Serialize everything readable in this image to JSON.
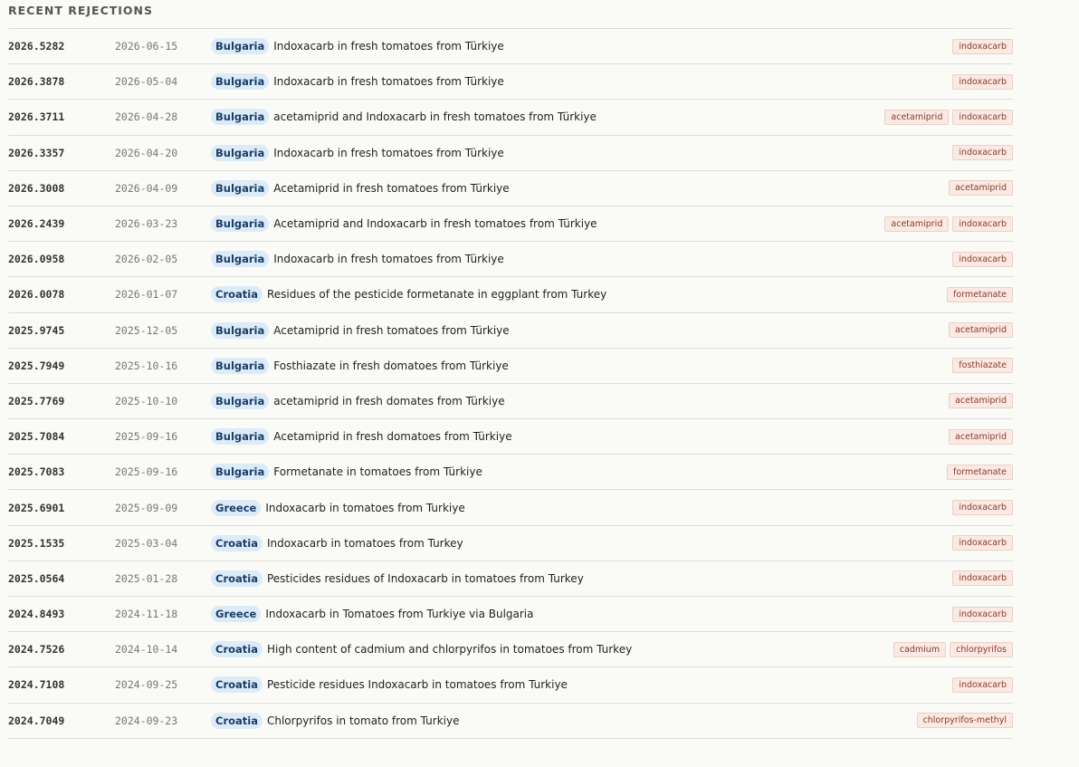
{
  "section_title": "RECENT REJECTIONS",
  "rows": [
    {
      "ref": "2026.5282",
      "date": "2026-06-15",
      "country": "Bulgaria",
      "subject": "Indoxacarb in fresh tomatoes from Türkiye",
      "tags": [
        "indoxacarb"
      ]
    },
    {
      "ref": "2026.3878",
      "date": "2026-05-04",
      "country": "Bulgaria",
      "subject": "Indoxacarb in fresh tomatoes from Türkiye",
      "tags": [
        "indoxacarb"
      ]
    },
    {
      "ref": "2026.3711",
      "date": "2026-04-28",
      "country": "Bulgaria",
      "subject": "acetamiprid and Indoxacarb in fresh tomatoes from Türkiye",
      "tags": [
        "acetamiprid",
        "indoxacarb"
      ]
    },
    {
      "ref": "2026.3357",
      "date": "2026-04-20",
      "country": "Bulgaria",
      "subject": "Indoxacarb in fresh tomatoes from Türkiye",
      "tags": [
        "indoxacarb"
      ]
    },
    {
      "ref": "2026.3008",
      "date": "2026-04-09",
      "country": "Bulgaria",
      "subject": "Acetamiprid in fresh tomatoes from Türkiye",
      "tags": [
        "acetamiprid"
      ]
    },
    {
      "ref": "2026.2439",
      "date": "2026-03-23",
      "country": "Bulgaria",
      "subject": "Acetamiprid and Indoxacarb in fresh tomatoes from Türkiye",
      "tags": [
        "acetamiprid",
        "indoxacarb"
      ]
    },
    {
      "ref": "2026.0958",
      "date": "2026-02-05",
      "country": "Bulgaria",
      "subject": "Indoxacarb in fresh tomatoes from Türkiye",
      "tags": [
        "indoxacarb"
      ]
    },
    {
      "ref": "2026.0078",
      "date": "2026-01-07",
      "country": "Croatia",
      "subject": "Residues of the pesticide formetanate in eggplant from Turkey",
      "tags": [
        "formetanate"
      ]
    },
    {
      "ref": "2025.9745",
      "date": "2025-12-05",
      "country": "Bulgaria",
      "subject": " Acetamiprid in fresh tomatoes from Türkiye",
      "tags": [
        "acetamiprid"
      ]
    },
    {
      "ref": "2025.7949",
      "date": "2025-10-16",
      "country": "Bulgaria",
      "subject": "Fosthiazate in fresh domatoes from Türkiye",
      "tags": [
        "fosthiazate"
      ]
    },
    {
      "ref": "2025.7769",
      "date": "2025-10-10",
      "country": "Bulgaria",
      "subject": "acetamiprid in fresh domates from Türkiye",
      "tags": [
        "acetamiprid"
      ]
    },
    {
      "ref": "2025.7084",
      "date": "2025-09-16",
      "country": "Bulgaria",
      "subject": "Acetamiprid in fresh domatoes from Türkiye",
      "tags": [
        "acetamiprid"
      ]
    },
    {
      "ref": "2025.7083",
      "date": "2025-09-16",
      "country": "Bulgaria",
      "subject": "Formetanate in tomatoes from Türkiye",
      "tags": [
        "formetanate"
      ]
    },
    {
      "ref": "2025.6901",
      "date": "2025-09-09",
      "country": "Greece",
      "subject": "Indoxacarb in tomatoes from Turkiye",
      "tags": [
        "indoxacarb"
      ]
    },
    {
      "ref": "2025.1535",
      "date": "2025-03-04",
      "country": "Croatia",
      "subject": "Indoxacarb in tomatoes from Turkey",
      "tags": [
        "indoxacarb"
      ]
    },
    {
      "ref": "2025.0564",
      "date": "2025-01-28",
      "country": "Croatia",
      "subject": "Pesticides residues of Indoxacarb in tomatoes from Turkey",
      "tags": [
        "indoxacarb"
      ]
    },
    {
      "ref": "2024.8493",
      "date": "2024-11-18",
      "country": "Greece",
      "subject": "Indoxacarb in Tomatoes from Turkiye via Bulgaria",
      "tags": [
        "indoxacarb"
      ]
    },
    {
      "ref": "2024.7526",
      "date": "2024-10-14",
      "country": "Croatia",
      "subject": "High content of cadmium and chlorpyrifos in tomatoes from Turkey",
      "tags": [
        "cadmium",
        "chlorpyrifos"
      ]
    },
    {
      "ref": "2024.7108",
      "date": "2024-09-25",
      "country": "Croatia",
      "subject": "Pesticide residues Indoxacarb in tomatoes from Turkiye",
      "tags": [
        "indoxacarb"
      ]
    },
    {
      "ref": "2024.7049",
      "date": "2024-09-23",
      "country": "Croatia",
      "subject": "Chlorpyrifos in tomato from Turkiye",
      "tags": [
        "chlorpyrifos-methyl"
      ]
    }
  ]
}
